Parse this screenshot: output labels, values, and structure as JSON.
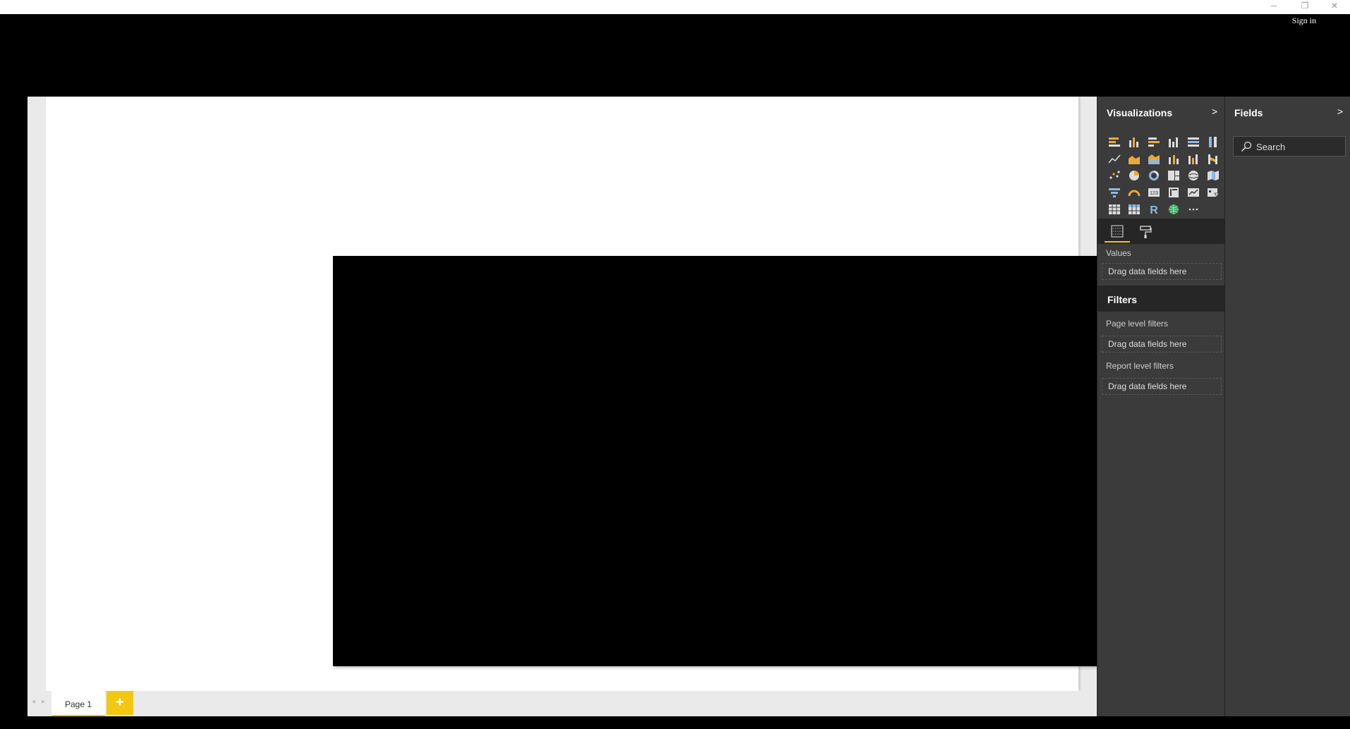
{
  "window": {
    "minimize_glyph": "─",
    "restore_glyph": "❐",
    "close_glyph": "✕",
    "sign_in_label": "Sign in"
  },
  "page_tabs": {
    "prev_glyph": "◂",
    "next_glyph": "▸",
    "active_page": "Page 1",
    "add_glyph": "+"
  },
  "visualizations": {
    "title": "Visualizations",
    "chevron": ">",
    "icons": [
      "stacked-bar-chart-icon",
      "stacked-column-chart-icon",
      "clustered-bar-chart-icon",
      "clustered-column-chart-icon",
      "100-stacked-bar-chart-icon",
      "100-stacked-column-chart-icon",
      "line-chart-icon",
      "area-chart-icon",
      "stacked-area-chart-icon",
      "line-and-stacked-column-chart-icon",
      "line-and-clustered-column-chart-icon",
      "ribbon-chart-icon",
      "scatter-chart-icon",
      "pie-chart-icon",
      "donut-chart-icon",
      "treemap-icon",
      "map-icon",
      "filled-map-icon",
      "funnel-icon",
      "gauge-icon",
      "card-icon",
      "multi-row-card-icon",
      "kpi-icon",
      "slicer-icon",
      "table-icon",
      "matrix-icon",
      "r-script-visual-icon",
      "globe-icon",
      "more-visuals-icon"
    ],
    "tabs": [
      "fields-tab-icon",
      "format-paint-roller-icon"
    ],
    "values_label": "Values",
    "values_drop": "Drag data fields here"
  },
  "filters": {
    "title": "Filters",
    "page_level_label": "Page level filters",
    "page_level_drop": "Drag data fields here",
    "report_level_label": "Report level filters",
    "report_level_drop": "Drag data fields here"
  },
  "fields": {
    "title": "Fields",
    "chevron": ">",
    "search_placeholder": "Search"
  },
  "colors": {
    "accent": "#f2c811",
    "pane_bg": "#3b3b3b",
    "pane_dark": "#262626",
    "canvas_bg": "#eaeaea"
  }
}
